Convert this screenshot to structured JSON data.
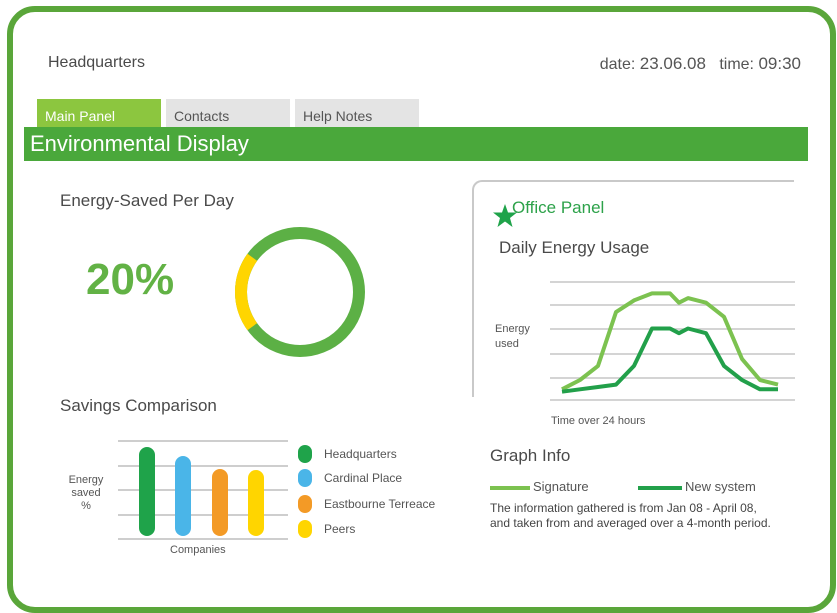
{
  "header": {
    "site_name": "Headquarters",
    "date_label": "date:",
    "date_value": "23.06.08",
    "time_label": "time:",
    "time_value": "09:30"
  },
  "tabs": [
    {
      "label": "Main Panel",
      "active": true
    },
    {
      "label": "Contacts",
      "active": false
    },
    {
      "label": "Help Notes",
      "active": false
    }
  ],
  "banner_title": "Environmental Display",
  "energy_saved": {
    "title": "Energy-Saved Per Day",
    "percent_label": "20%",
    "percent_value": 20,
    "ring_colors": {
      "saved": "#ffd500",
      "rest": "#5cb045"
    }
  },
  "savings_comparison": {
    "title": "Savings Comparison",
    "ylabel_lines": [
      "Energy",
      "saved",
      "%"
    ],
    "xlabel": "Companies",
    "legend": [
      {
        "label": "Headquarters",
        "color": "#1fa34a"
      },
      {
        "label": "Cardinal Place",
        "color": "#4ab5e8"
      },
      {
        "label": "Eastbourne Terreace",
        "color": "#f39a26"
      },
      {
        "label": "Peers",
        "color": "#ffd500"
      }
    ]
  },
  "office_panel": {
    "icon": "star-icon",
    "title": "Office Panel",
    "chart_title": "Daily Energy Usage",
    "ylabel_lines": [
      "Energy",
      "used"
    ],
    "xlabel": "Time over 24 hours"
  },
  "graph_info": {
    "title": "Graph Info",
    "legend": [
      {
        "label": "Signature",
        "color": "#7cc250"
      },
      {
        "label": "New system",
        "color": "#22a04a"
      }
    ],
    "description": "The information gathered is from Jan 08 - April 08, and taken from and averaged over a 4-month period."
  },
  "chart_data": [
    {
      "type": "bar",
      "title": "Savings Comparison",
      "xlabel": "Companies",
      "ylabel": "Energy saved %",
      "categories": [
        "Headquarters",
        "Cardinal Place",
        "Eastbourne Terreace",
        "Peers"
      ],
      "values": [
        89,
        80,
        67,
        66
      ],
      "ylim": [
        0,
        100
      ],
      "colors": [
        "#1fa34a",
        "#4ab5e8",
        "#f39a26",
        "#ffd500"
      ],
      "grid": true
    },
    {
      "type": "line",
      "title": "Daily Energy Usage",
      "xlabel": "Time over 24 hours",
      "ylabel": "Energy used",
      "x": [
        0,
        2,
        4,
        6,
        8,
        10,
        12,
        13,
        14,
        16,
        18,
        20,
        22,
        24
      ],
      "ylim": [
        0,
        5
      ],
      "grid": true,
      "series": [
        {
          "name": "Signature",
          "color": "#7cc250",
          "values": [
            0.2,
            0.6,
            1.2,
            3.5,
            4.0,
            4.3,
            4.3,
            3.9,
            4.1,
            3.9,
            3.3,
            1.5,
            0.6,
            0.4
          ]
        },
        {
          "name": "New system",
          "color": "#22a04a",
          "values": [
            0.1,
            0.2,
            0.3,
            0.4,
            1.2,
            2.8,
            2.8,
            2.6,
            2.8,
            2.6,
            1.2,
            0.6,
            0.2,
            0.2
          ]
        }
      ]
    }
  ]
}
